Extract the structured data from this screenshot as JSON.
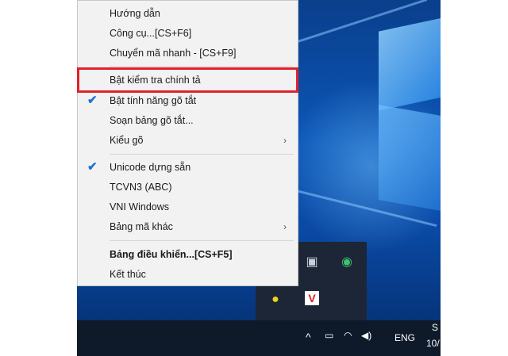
{
  "menu": {
    "items": [
      {
        "label": "Hướng dẫn",
        "checked": false,
        "submenu": false
      },
      {
        "label": "Công cụ...[CS+F6]",
        "checked": false,
        "submenu": false
      },
      {
        "label": "Chuyển mã nhanh - [CS+F9]",
        "checked": false,
        "submenu": false
      },
      {
        "label": "Bật kiểm tra chính tả",
        "checked": false,
        "submenu": false,
        "highlighted": true
      },
      {
        "label": "Bật tính năng gõ tắt",
        "checked": true,
        "submenu": false
      },
      {
        "label": "Soạn bảng gõ tắt...",
        "checked": false,
        "submenu": false
      },
      {
        "label": "Kiểu gõ",
        "checked": false,
        "submenu": true
      },
      {
        "label": "Unicode dựng sẵn",
        "checked": true,
        "submenu": false
      },
      {
        "label": "TCVN3 (ABC)",
        "checked": false,
        "submenu": false
      },
      {
        "label": "VNI Windows",
        "checked": false,
        "submenu": false
      },
      {
        "label": "Bảng mã khác",
        "checked": false,
        "submenu": true
      },
      {
        "label": "Bảng điều khiển...[CS+F5]",
        "checked": false,
        "submenu": false,
        "bold": true
      },
      {
        "label": "Kết thúc",
        "checked": false,
        "submenu": false
      }
    ],
    "check_glyph": "✔",
    "arrow_glyph": "›"
  },
  "taskbar": {
    "up_arrow": "^",
    "language": "ENG",
    "clock_partial_top": "S",
    "clock_partial_bottom": "10/"
  },
  "tray_icons": [
    "monitor-icon",
    "network-globe-icon",
    "yellow-note-icon",
    "v-app-icon"
  ],
  "colors": {
    "highlight_border": "#e0222a",
    "highlight_fill": "#9cc9ee",
    "check": "#1e73d6",
    "taskbar": "#0e1a2a"
  }
}
